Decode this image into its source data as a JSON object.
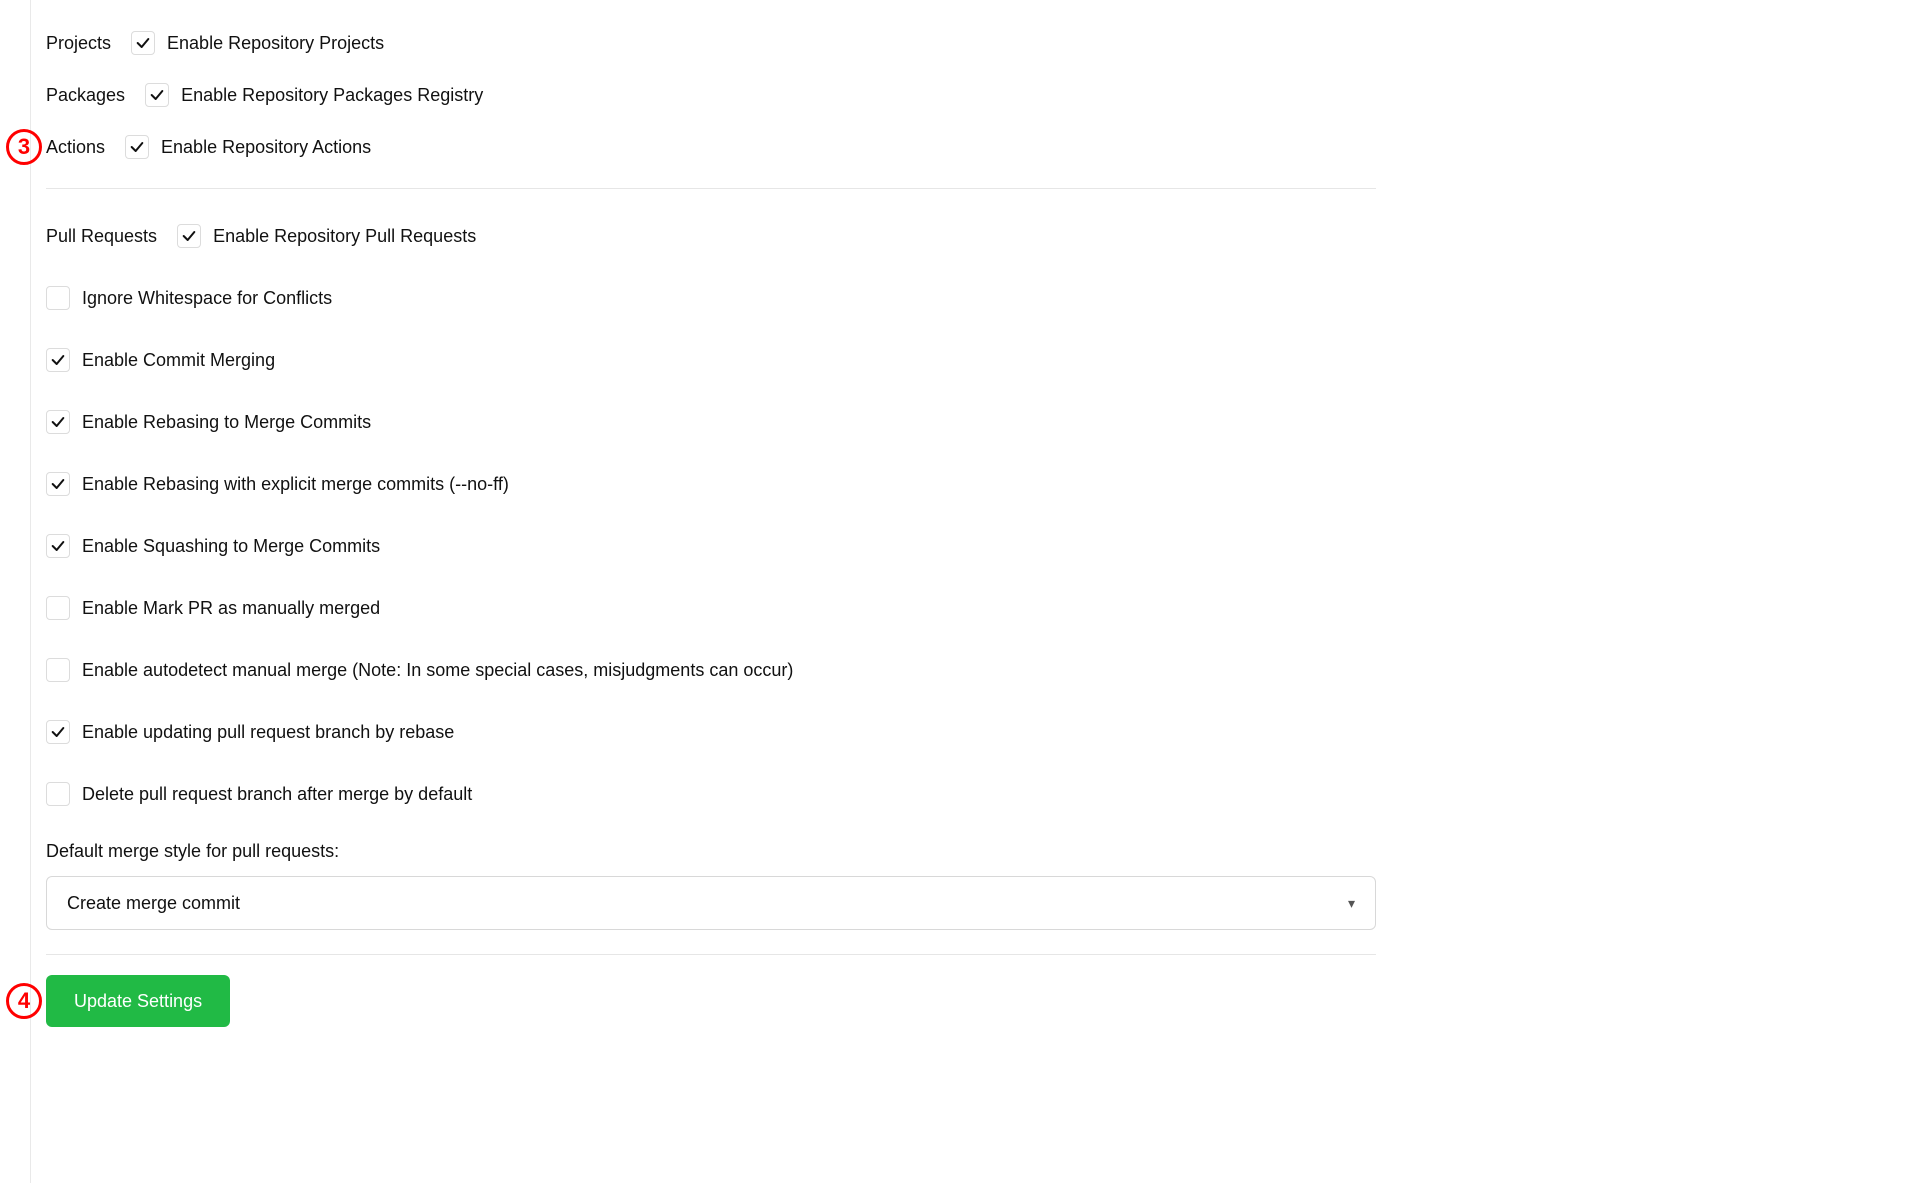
{
  "markers": {
    "m3": "3",
    "m4": "4"
  },
  "sections": {
    "projects": {
      "label": "Projects",
      "checkbox": true,
      "text": "Enable Repository Projects"
    },
    "packages": {
      "label": "Packages",
      "checkbox": true,
      "text": "Enable Repository Packages Registry"
    },
    "actions": {
      "label": "Actions",
      "checkbox": true,
      "text": "Enable Repository Actions"
    },
    "pull": {
      "label": "Pull Requests",
      "checkbox": true,
      "text": "Enable Repository Pull Requests"
    }
  },
  "pull_options": {
    "ignore_whitespace": {
      "checked": false,
      "text": "Ignore Whitespace for Conflicts"
    },
    "commit_merging": {
      "checked": true,
      "text": "Enable Commit Merging"
    },
    "rebase_merge": {
      "checked": true,
      "text": "Enable Rebasing to Merge Commits"
    },
    "rebase_noff": {
      "checked": true,
      "text": "Enable Rebasing with explicit merge commits (--no-ff)"
    },
    "squash": {
      "checked": true,
      "text": "Enable Squashing to Merge Commits"
    },
    "mark_manual": {
      "checked": false,
      "text": "Enable Mark PR as manually merged"
    },
    "autodetect": {
      "checked": false,
      "text": "Enable autodetect manual merge (Note: In some special cases, misjudgments can occur)"
    },
    "update_rebase": {
      "checked": true,
      "text": "Enable updating pull request branch by rebase"
    },
    "delete_branch": {
      "checked": false,
      "text": "Delete pull request branch after merge by default"
    }
  },
  "merge_style": {
    "label": "Default merge style for pull requests:",
    "selected": "Create merge commit"
  },
  "buttons": {
    "update": "Update Settings"
  }
}
